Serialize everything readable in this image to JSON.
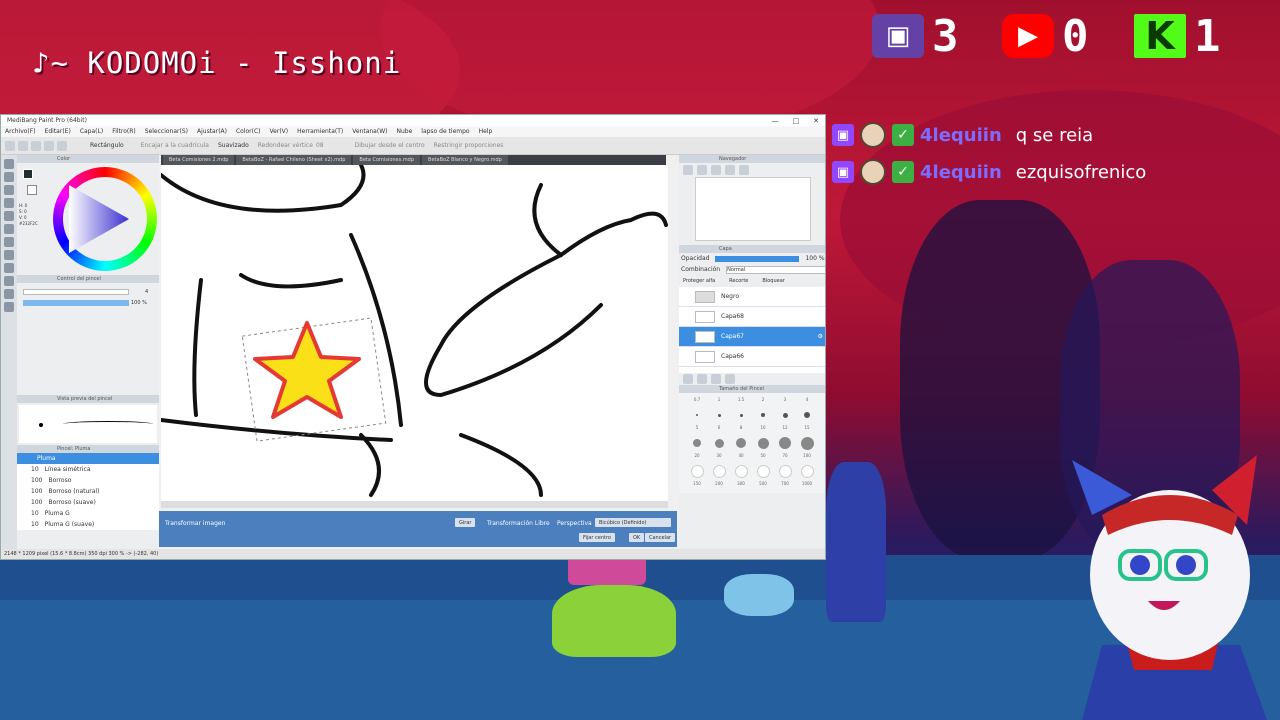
{
  "overlay": {
    "song": "♪~ KODOMOi - Isshoni",
    "counters": [
      {
        "icon": "twitch-icon",
        "color": "#6441a5",
        "value": "3"
      },
      {
        "icon": "youtube-icon",
        "color": "#ff0000",
        "value": "0"
      },
      {
        "icon": "kick-icon",
        "color": "#53fc18",
        "value": "1"
      }
    ]
  },
  "chat": [
    {
      "user": "4lequiin",
      "message": "q se reia"
    },
    {
      "user": "4lequiin",
      "message": "ezquisofrenico"
    }
  ],
  "app": {
    "title": "MediBang Paint Pro (64bit)",
    "menu": [
      "Archivo(F)",
      "Editar(E)",
      "Capa(L)",
      "Filtro(R)",
      "Seleccionar(S)",
      "Ajustar(A)",
      "Color(C)",
      "Ver(V)",
      "Herramienta(T)",
      "Ventana(W)",
      "Nube",
      "lapso de tiempo",
      "Help"
    ],
    "toolbar": {
      "rect": "Rectángulo",
      "snap": "Encajar a la cuadrícula",
      "smooth": "Suavizado",
      "round": "Redondear vértice",
      "round_val": "08",
      "center": "Dibujar desde el centro",
      "restrict": "Restringir proporciones"
    },
    "tabs": [
      "Beta Comisiones 2.mdp",
      "BetaBoZ - Rafael Chileno (Sheet x2).mdp",
      "Beta Comisiones.mdp",
      "BetaBoZ Blanco y Negro.mdp"
    ],
    "panels": {
      "color": "Color",
      "brush_control": "Control del pincel",
      "brush_preview": "Vista previa del pincel",
      "brush_list": "Pincel: Pluma",
      "navigator": "Navegador",
      "layer": "Capa",
      "brush_size": "Tamaño del Pincel"
    },
    "color_info": {
      "h": "H: 0",
      "s": "S: 0",
      "v": "V: 0",
      "hex": "#232F2C"
    },
    "brush_control": {
      "size": "4",
      "opacity": "100 %"
    },
    "brushes": [
      {
        "size": "",
        "name": "Pluma"
      },
      {
        "size": "10",
        "name": "Línea simétrica"
      },
      {
        "size": "100",
        "name": "Borroso"
      },
      {
        "size": "100",
        "name": "Borroso (natural)"
      },
      {
        "size": "100",
        "name": "Borroso (suave)"
      },
      {
        "size": "10",
        "name": "Pluma G"
      },
      {
        "size": "10",
        "name": "Pluma G (suave)"
      }
    ],
    "layer_panel": {
      "opacity_label": "Opacidad",
      "opacity_value": "100 %",
      "blend_label": "Combinación",
      "blend_value": "Normal",
      "protect": "Proteger alfa",
      "clip": "Recorte",
      "lock": "Bloquear",
      "layers": [
        {
          "name": "Negro",
          "type": "folder"
        },
        {
          "name": "Capa68",
          "type": "layer"
        },
        {
          "name": "Capa67",
          "type": "layer",
          "selected": true
        },
        {
          "name": "Capa66",
          "type": "layer"
        }
      ]
    },
    "brush_sizes": {
      "row1": [
        "0.7",
        "1",
        "1.5",
        "2",
        "3",
        "4"
      ],
      "row2": [
        "5",
        "6",
        "8",
        "10",
        "12",
        "15"
      ],
      "row3": [
        "20",
        "30",
        "40",
        "50",
        "70",
        "100"
      ],
      "row4": [
        "150",
        "200",
        "300",
        "500",
        "700",
        "1000"
      ]
    },
    "transform": {
      "label": "Transformar imagen",
      "rotate": "Girar",
      "free": "Transformación Libre",
      "perspective": "Perspectiva",
      "interp": "Bicúbico (Definido)",
      "center": "Fijar centro",
      "ok": "OK",
      "cancel": "Cancelar"
    },
    "status": "2148 * 1209 pixel  (15.6 * 8.8cm)  350 dpi  300 %  -> (-282, 40)"
  }
}
